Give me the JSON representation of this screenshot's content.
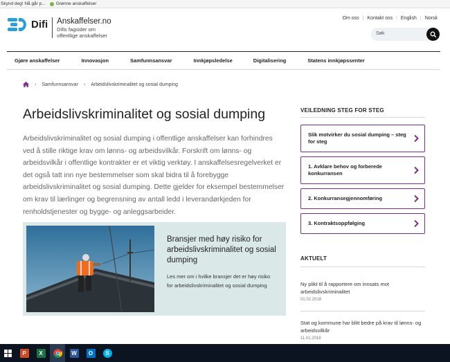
{
  "bookmarks": [
    {
      "label": "Skynd deg! Nå går p..."
    },
    {
      "label": "Grønne anskaffelser"
    }
  ],
  "top_links": {
    "about": "Om oss",
    "contact": "Kontakt oss",
    "english": "English",
    "norsk": "Norsk"
  },
  "logo": {
    "brand": "Difi",
    "site_name": "Anskaffelser.no",
    "tagline_1": "Difis fagsider om",
    "tagline_2": "offentlige anskaffelser"
  },
  "search": {
    "placeholder": "Søk"
  },
  "nav": [
    {
      "label": "Gjøre anskaffelser"
    },
    {
      "label": "Innovasjon"
    },
    {
      "label": "Samfunnsansvar"
    },
    {
      "label": "Innkjøpsledelse"
    },
    {
      "label": "Digitalisering"
    },
    {
      "label": "Statens innkjøpssenter"
    }
  ],
  "breadcrumb": {
    "section": "Samfunnsansvar",
    "current": "Arbeidslivskriminalitet og sosial dumping"
  },
  "page": {
    "title": "Arbeidslivskriminalitet og sosial dumping",
    "ingress": "Arbeidslivskriminalitet og sosial dumping i offentlige anskaffelser kan forhindres ved å stille riktige krav om lønns- og arbeidsvilkår. Forskrift om lønns- og arbeidsvilkår i offentlige kontrakter er et viktig verktøy. I anskaffelsesregelverket er det også tatt inn nye bestemmelser som skal bidra til å forebygge arbeidslivskriminalitet og sosial dumping. Dette gjelder for eksempel bestemmelser om krav til lærlinger og begrensning av antall ledd i leverandørkjeden for renholdstjenester og bygge- og anleggsarbeider."
  },
  "feature": {
    "title": "Bransjer med høy risiko for arbeidslivskriminalitet og sosial dumping",
    "text": "Les mer om i hvilke bransjer det er høy risiko for arbeidslivskriminalitet og sosial dumping"
  },
  "guide": {
    "heading": "VEILEDNING STEG FOR STEG",
    "steps": [
      {
        "label": "Slik motvirker du sosial dumping – steg for steg"
      },
      {
        "label": "1. Avklare behov og forberede konkurransen"
      },
      {
        "label": "2. Konkurransegjennomføring"
      },
      {
        "label": "3. Kontraktsoppfølging"
      }
    ]
  },
  "news": {
    "heading": "AKTUELT",
    "items": [
      {
        "title": "Ny plikt til å rapportere om innsats mot arbeidslivskriminalitet",
        "date": "01.02.2018"
      },
      {
        "title": "Stat og kommune har blitt bedre på krav til lønns- og arbeidsvilkår",
        "date": "11.01.2018"
      }
    ]
  },
  "colors": {
    "accent": "#7b2f8a",
    "brand_blue": "#2a9fd8",
    "feature_bg": "#dbe8e8"
  },
  "taskbar": [
    "windows-start-icon",
    "powerpoint-icon",
    "excel-icon",
    "chrome-icon",
    "word-icon",
    "outlook-icon",
    "skype-icon"
  ]
}
